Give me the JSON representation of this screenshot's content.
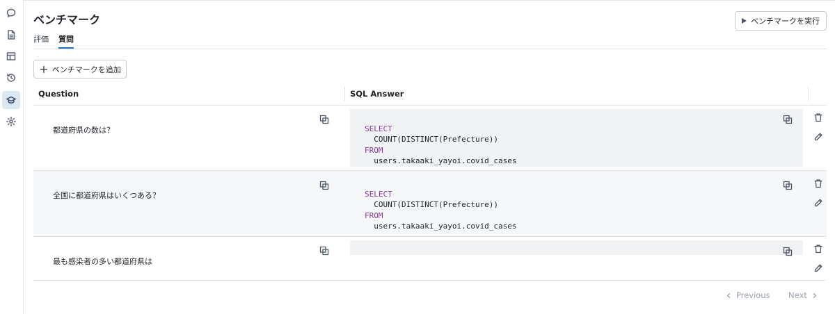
{
  "rail": {
    "items": [
      {
        "icon": "chat-bubble-icon",
        "active": false
      },
      {
        "icon": "document-icon",
        "active": false
      },
      {
        "icon": "table-icon",
        "active": false
      },
      {
        "icon": "history-icon",
        "active": false
      },
      {
        "icon": "graduation-cap-icon",
        "active": true
      },
      {
        "icon": "gear-icon",
        "active": false
      }
    ]
  },
  "header": {
    "title": "ベンチマーク",
    "run_label": "ベンチマークを実行"
  },
  "tabs": [
    {
      "label": "評価",
      "active": false
    },
    {
      "label": "質問",
      "active": true
    }
  ],
  "toolbar": {
    "add_label": "ベンチマークを追加"
  },
  "table": {
    "columns": [
      "Question",
      "SQL Answer"
    ],
    "rows": [
      {
        "question": "都道府県の数は？",
        "sql": [
          {
            "kw": "SELECT",
            "rest": ""
          },
          {
            "kw": "",
            "rest": "  COUNT(DISTINCT(Prefecture))"
          },
          {
            "kw": "FROM",
            "rest": ""
          },
          {
            "kw": "",
            "rest": "  users.takaaki_yayoi.covid_cases"
          }
        ]
      },
      {
        "question": "全国に都道府県はいくつある？",
        "sql": [
          {
            "kw": "SELECT",
            "rest": ""
          },
          {
            "kw": "",
            "rest": "  COUNT(DISTINCT(Prefecture))"
          },
          {
            "kw": "FROM",
            "rest": ""
          },
          {
            "kw": "",
            "rest": "  users.takaaki_yayoi.covid_cases"
          }
        ]
      },
      {
        "question": "最も感染者の多い都道府県は",
        "sql": []
      }
    ]
  },
  "pagination": {
    "previous_label": "Previous",
    "next_label": "Next"
  },
  "colors": {
    "accent": "#2272b4",
    "keyword": "#8c3a9e",
    "active_rail": "#dde7f1"
  }
}
